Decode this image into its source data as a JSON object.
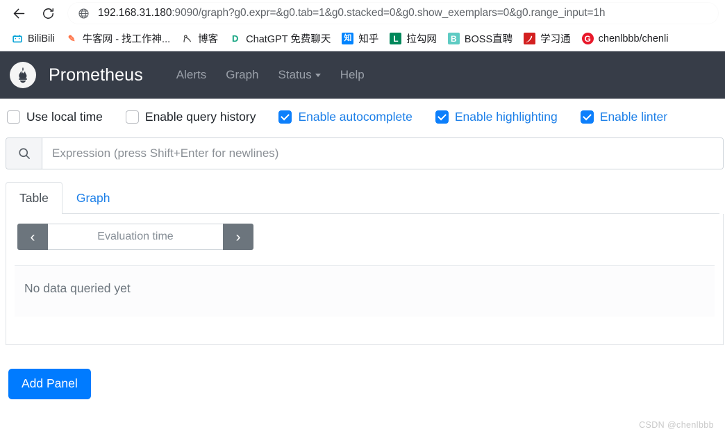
{
  "browser": {
    "back_icon": "arrow-left-icon",
    "reload_icon": "reload-icon",
    "globe_icon": "globe-icon",
    "url_host": "192.168.31.180",
    "url_rest": ":9090/graph?g0.expr=&g0.tab=1&g0.stacked=0&g0.show_exemplars=0&g0.range_input=1h",
    "url_full": "192.168.31.180:9090/graph?g0.expr=&g0.tab=1&g0.stacked=0&g0.show_exemplars=0&g0.range_input=1h"
  },
  "bookmarks": [
    {
      "label": "BiliBili",
      "icon": "bilibili-icon",
      "glyph": "▣",
      "cls": "ico-bili"
    },
    {
      "label": "牛客网 - 找工作神...",
      "icon": "nowcoder-icon",
      "glyph": "✎",
      "cls": "ico-nowcoder"
    },
    {
      "label": "博客",
      "icon": "blog-icon",
      "glyph": "❀",
      "cls": "ico-boke"
    },
    {
      "label": "ChatGPT 免费聊天",
      "icon": "chatgpt-icon",
      "glyph": "D",
      "cls": "ico-chatgpt"
    },
    {
      "label": "知乎",
      "icon": "zhihu-icon",
      "glyph": "知",
      "cls": "ico-zhihu"
    },
    {
      "label": "拉勾网",
      "icon": "lagou-icon",
      "glyph": "L",
      "cls": "ico-lagou"
    },
    {
      "label": "BOSS直聘",
      "icon": "boss-icon",
      "glyph": "B",
      "cls": "ico-boss"
    },
    {
      "label": "学习通",
      "icon": "xuexitong-icon",
      "glyph": "学",
      "cls": "ico-xxt"
    },
    {
      "label": "chenlbbb/chenli",
      "icon": "gitee-icon",
      "glyph": "G",
      "cls": "ico-github"
    }
  ],
  "navbar": {
    "brand": "Prometheus",
    "logo_icon": "prometheus-torch-logo",
    "links": [
      {
        "label": "Alerts",
        "caret": false
      },
      {
        "label": "Graph",
        "caret": false
      },
      {
        "label": "Status",
        "caret": true
      },
      {
        "label": "Help",
        "caret": false
      }
    ]
  },
  "options": [
    {
      "label": "Use local time",
      "checked": false
    },
    {
      "label": "Enable query history",
      "checked": false
    },
    {
      "label": "Enable autocomplete",
      "checked": true
    },
    {
      "label": "Enable highlighting",
      "checked": true
    },
    {
      "label": "Enable linter",
      "checked": true
    }
  ],
  "expression": {
    "search_icon": "search-icon",
    "value": "",
    "placeholder": "Expression (press Shift+Enter for newlines)"
  },
  "tabs": [
    {
      "label": "Table",
      "active": true
    },
    {
      "label": "Graph",
      "active": false
    }
  ],
  "evaluation": {
    "prev_icon": "chevron-left-icon",
    "next_icon": "chevron-right-icon",
    "prev_glyph": "‹",
    "next_glyph": "›",
    "value": "",
    "placeholder": "Evaluation time"
  },
  "result": {
    "empty_message": "No data queried yet"
  },
  "actions": {
    "add_panel_label": "Add Panel"
  },
  "watermark": "CSDN @chenlbbb",
  "colors": {
    "navbar_bg": "#373d48",
    "accent_blue": "#007bff",
    "link_blue": "#1c7fe8",
    "muted": "#6c757d",
    "eval_btn": "#6c757d"
  }
}
